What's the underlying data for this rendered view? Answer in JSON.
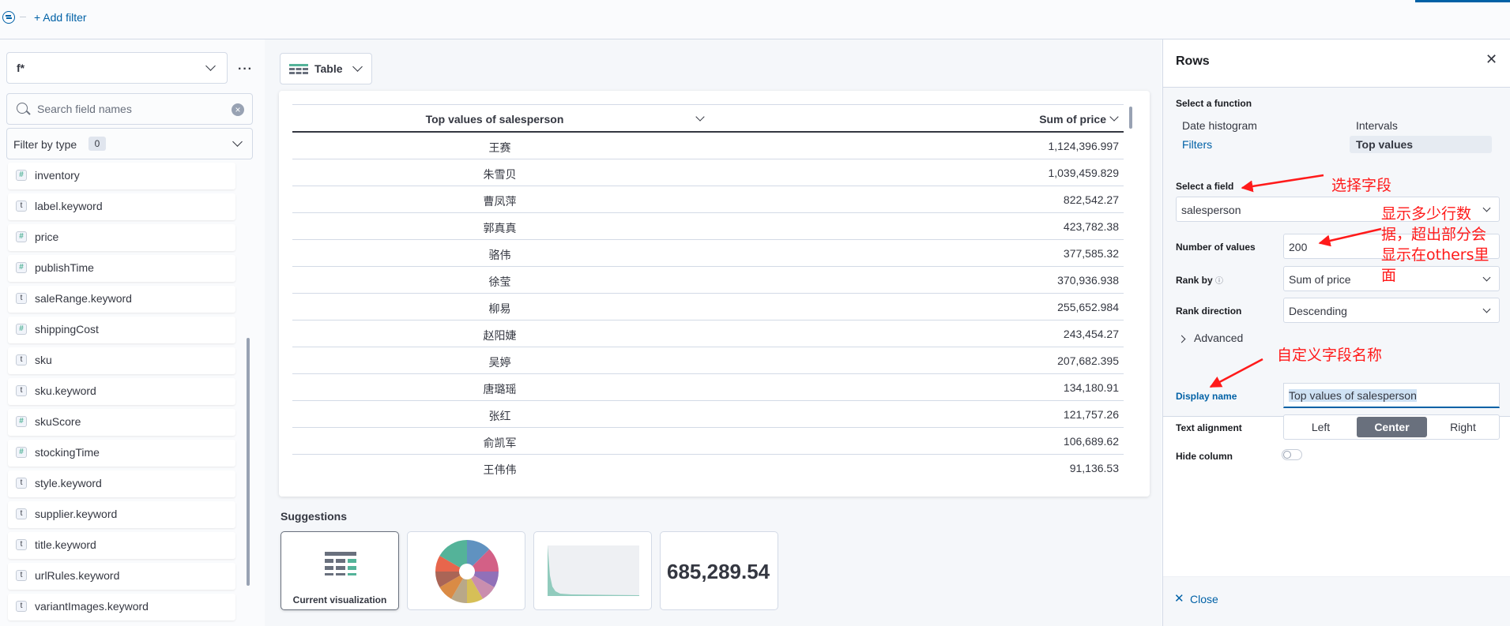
{
  "topbar": {
    "add_filter": "+ Add filter"
  },
  "sidebar": {
    "index_pattern": "f*",
    "search_placeholder": "Search field names",
    "filter_by_type": "Filter by type",
    "filter_count": "0",
    "fields": [
      {
        "type": "number",
        "glyph": "#",
        "name": "inventory"
      },
      {
        "type": "string",
        "glyph": "t",
        "name": "label.keyword"
      },
      {
        "type": "number",
        "glyph": "#",
        "name": "price"
      },
      {
        "type": "number",
        "glyph": "#",
        "name": "publishTime"
      },
      {
        "type": "string",
        "glyph": "t",
        "name": "saleRange.keyword"
      },
      {
        "type": "number",
        "glyph": "#",
        "name": "shippingCost"
      },
      {
        "type": "string",
        "glyph": "t",
        "name": "sku"
      },
      {
        "type": "string",
        "glyph": "t",
        "name": "sku.keyword"
      },
      {
        "type": "number",
        "glyph": "#",
        "name": "skuScore"
      },
      {
        "type": "number",
        "glyph": "#",
        "name": "stockingTime"
      },
      {
        "type": "string",
        "glyph": "t",
        "name": "style.keyword"
      },
      {
        "type": "string",
        "glyph": "t",
        "name": "supplier.keyword"
      },
      {
        "type": "string",
        "glyph": "t",
        "name": "title.keyword"
      },
      {
        "type": "string",
        "glyph": "t",
        "name": "urlRules.keyword"
      },
      {
        "type": "string",
        "glyph": "t",
        "name": "variantImages.keyword"
      }
    ]
  },
  "workspace": {
    "vis_type": "Table",
    "table": {
      "col1": "Top values of salesperson",
      "col2": "Sum of price",
      "rows": [
        [
          "王赛",
          "1,124,396.997"
        ],
        [
          "朱雪贝",
          "1,039,459.829"
        ],
        [
          "曹凤萍",
          "822,542.27"
        ],
        [
          "郭真真",
          "423,782.38"
        ],
        [
          "骆伟",
          "377,585.32"
        ],
        [
          "徐莹",
          "370,936.938"
        ],
        [
          "柳易",
          "255,652.984"
        ],
        [
          "赵阳婕",
          "243,454.27"
        ],
        [
          "吴婷",
          "207,682.395"
        ],
        [
          "唐璐瑶",
          "134,180.91"
        ],
        [
          "张红",
          "121,757.26"
        ],
        [
          "俞凯军",
          "106,689.62"
        ],
        [
          "王伟伟",
          "91,136.53"
        ]
      ]
    },
    "suggestions_title": "Suggestions",
    "suggestions": {
      "current_label": "Current visualization",
      "metric_value": "685,289.54"
    }
  },
  "panel": {
    "title": "Rows",
    "select_function": "Select a function",
    "functions": [
      "Date histogram",
      "Intervals",
      "Filters",
      "Top values"
    ],
    "select_field": "Select a field",
    "field_value": "salesperson",
    "number_of_values": "Number of values",
    "number_value": "200",
    "rank_by": "Rank by",
    "rank_by_value": "Sum of price",
    "rank_direction": "Rank direction",
    "rank_direction_value": "Descending",
    "advanced": "Advanced",
    "display_name": "Display name",
    "display_name_value": "Top values of salesperson",
    "text_alignment": "Text alignment",
    "alignment_options": [
      "Left",
      "Center",
      "Right"
    ],
    "alignment_selected": "Center",
    "hide_column": "Hide column",
    "close": "Close"
  },
  "annotations": {
    "select_field_note": "选择字段",
    "number_note": [
      "显示多少行数",
      "据，超出部分会",
      "显示在others里",
      "面"
    ],
    "display_name_note": "自定义字段名称"
  },
  "colors": {
    "link": "#0061a6",
    "annotation": "#ff1a1a",
    "numeric_field": "#54b399",
    "segment_selected": "#69707d"
  }
}
